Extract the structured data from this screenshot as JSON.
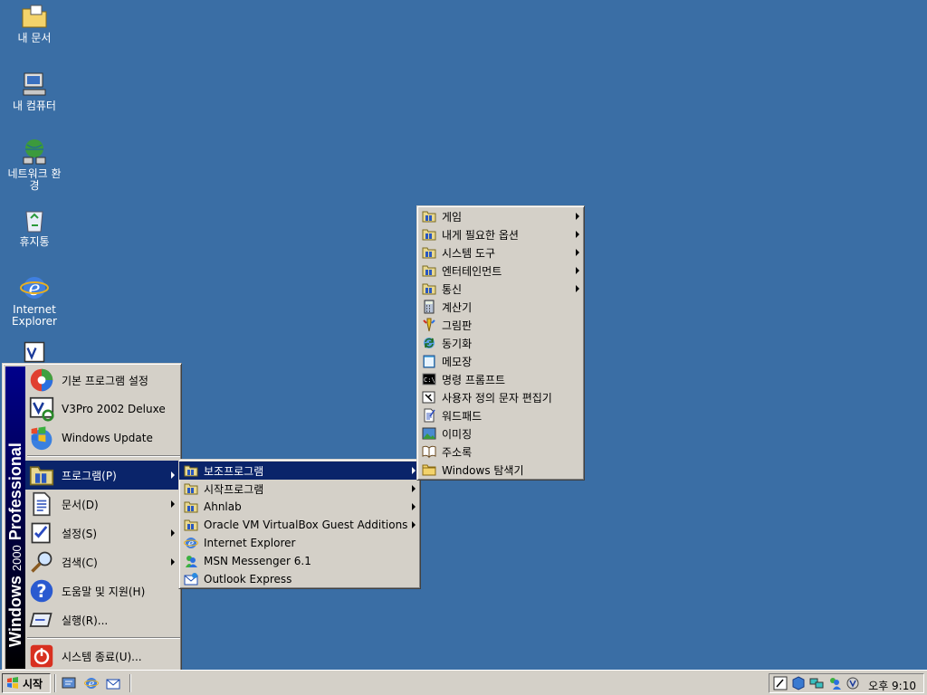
{
  "desktop": {
    "icons": [
      {
        "label": "내 문서",
        "icon": "my-documents-icon"
      },
      {
        "label": "내 컴퓨터",
        "icon": "my-computer-icon"
      },
      {
        "label": "네트워크 환경",
        "icon": "network-places-icon"
      },
      {
        "label": "휴지통",
        "icon": "recycle-bin-icon"
      },
      {
        "label": "Internet Explorer",
        "icon": "internet-explorer-icon"
      }
    ]
  },
  "start_menu": {
    "banner_brand": "Windows",
    "banner_version": "2000",
    "banner_edition": "Professional",
    "top_items": [
      {
        "label": "기본 프로그램 설정",
        "icon": "default-programs-icon"
      },
      {
        "label": "V3Pro 2002 Deluxe",
        "icon": "v3pro-icon"
      },
      {
        "label": "Windows Update",
        "icon": "windows-update-icon"
      }
    ],
    "items": [
      {
        "label": "프로그램(P)",
        "icon": "programs-folder-icon",
        "submenu": true,
        "highlighted": true
      },
      {
        "label": "문서(D)",
        "icon": "documents-icon",
        "submenu": true
      },
      {
        "label": "설정(S)",
        "icon": "settings-icon",
        "submenu": true
      },
      {
        "label": "검색(C)",
        "icon": "search-icon",
        "submenu": true
      },
      {
        "label": "도움말 및 지원(H)",
        "icon": "help-icon",
        "submenu": false
      },
      {
        "label": "실행(R)...",
        "icon": "run-icon",
        "submenu": false
      }
    ],
    "shutdown": {
      "label": "시스템 종료(U)...",
      "icon": "shutdown-icon"
    }
  },
  "programs_menu": {
    "items": [
      {
        "label": "보조프로그램",
        "icon": "program-group-icon",
        "submenu": true,
        "highlighted": true
      },
      {
        "label": "시작프로그램",
        "icon": "program-group-icon",
        "submenu": true
      },
      {
        "label": "Ahnlab",
        "icon": "program-group-icon",
        "submenu": true
      },
      {
        "label": "Oracle VM VirtualBox Guest Additions",
        "icon": "program-group-icon",
        "submenu": true
      },
      {
        "label": "Internet Explorer",
        "icon": "internet-explorer-icon",
        "submenu": false
      },
      {
        "label": "MSN Messenger 6.1",
        "icon": "msn-messenger-icon",
        "submenu": false
      },
      {
        "label": "Outlook Express",
        "icon": "outlook-express-icon",
        "submenu": false
      }
    ]
  },
  "accessories_menu": {
    "items": [
      {
        "label": "게임",
        "icon": "program-group-icon",
        "submenu": true
      },
      {
        "label": "내게 필요한 옵션",
        "icon": "program-group-icon",
        "submenu": true
      },
      {
        "label": "시스템 도구",
        "icon": "program-group-icon",
        "submenu": true
      },
      {
        "label": "엔터테인먼트",
        "icon": "program-group-icon",
        "submenu": true
      },
      {
        "label": "통신",
        "icon": "program-group-icon",
        "submenu": true
      },
      {
        "label": "계산기",
        "icon": "calculator-icon",
        "submenu": false
      },
      {
        "label": "그림판",
        "icon": "paint-icon",
        "submenu": false
      },
      {
        "label": "동기화",
        "icon": "synchronize-icon",
        "submenu": false
      },
      {
        "label": "메모장",
        "icon": "notepad-icon",
        "submenu": false
      },
      {
        "label": "명령 프롬프트",
        "icon": "command-prompt-icon",
        "submenu": false
      },
      {
        "label": "사용자 정의 문자 편집기",
        "icon": "character-editor-icon",
        "submenu": false
      },
      {
        "label": "워드패드",
        "icon": "wordpad-icon",
        "submenu": false
      },
      {
        "label": "이미징",
        "icon": "imaging-icon",
        "submenu": false
      },
      {
        "label": "주소록",
        "icon": "address-book-icon",
        "submenu": false
      },
      {
        "label": "Windows 탐색기",
        "icon": "windows-explorer-icon",
        "submenu": false
      }
    ]
  },
  "taskbar": {
    "start_label": "시작",
    "quick_launch": [
      "show-desktop-icon",
      "internet-explorer-icon",
      "outlook-express-icon"
    ],
    "tray_icons": [
      "ime-icon",
      "virtualbox-tray-icon",
      "network-tray-icon",
      "msn-tray-icon",
      "v3-tray-icon"
    ],
    "clock": "오후 9:10"
  },
  "colors": {
    "desktop": "#3a6ea5",
    "menu": "#d4d0c8",
    "highlight": "#0a246a"
  }
}
